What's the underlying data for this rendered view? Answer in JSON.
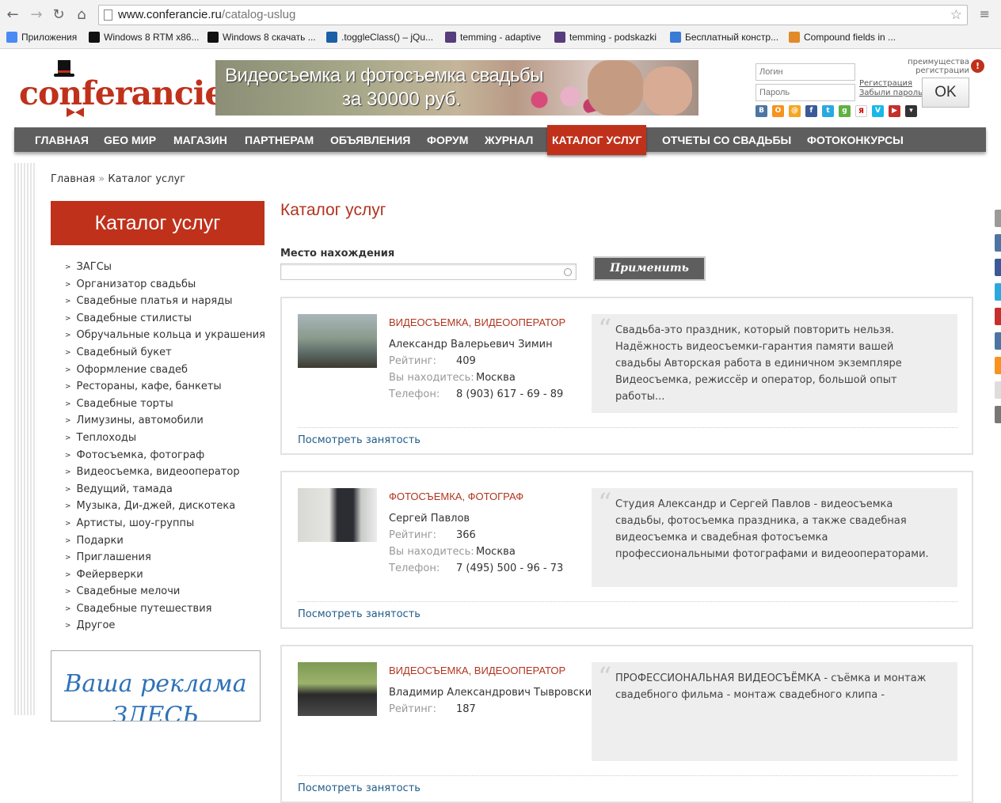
{
  "browser": {
    "url_host": "www.conferancie.ru",
    "url_path": "/catalog-uslug",
    "bookmarks": [
      {
        "label": "Приложения",
        "icon": "apps-grid-icon",
        "color": "#4a8af4"
      },
      {
        "label": "Windows 8 RTM x86...",
        "icon": "tabs-site-icon",
        "color": "#111111"
      },
      {
        "label": "Windows 8 скачать ...",
        "icon": "tabs-site-icon",
        "color": "#111111"
      },
      {
        "label": ".toggleClass() – jQu...",
        "icon": "jquery-icon",
        "color": "#1b5fa6"
      },
      {
        "label": "temming - adaptive",
        "icon": "bootstrap-icon",
        "color": "#563d7c"
      },
      {
        "label": "temming - podskazki",
        "icon": "bootstrap-icon",
        "color": "#563d7c"
      },
      {
        "label": "Бесплатный констр...",
        "icon": "constructor-icon",
        "color": "#3a7bd5"
      },
      {
        "label": "Compound fields in ...",
        "icon": "puzzle-icon",
        "color": "#e08a2a"
      }
    ]
  },
  "header": {
    "logo_text": "conferancie",
    "banner_line1": "Видеосъемка и фотосъемка свадьбы",
    "banner_line2": "за 30000 руб.",
    "login_placeholder": "Логин",
    "password_placeholder": "Пароль",
    "register_link": "Регистрация",
    "forgot_link": "Забыли пароль?",
    "ok_label": "OK",
    "privileges_line1": "преимущества",
    "privileges_line2": "регистрации",
    "privileges_icon": "!",
    "socials": [
      {
        "icon": "vk-icon",
        "color": "#4c75a3",
        "glyph": "B"
      },
      {
        "icon": "odnoklassniki-icon",
        "color": "#f7931e",
        "glyph": "O"
      },
      {
        "icon": "mailru-icon",
        "color": "#f5a623",
        "glyph": "@"
      },
      {
        "icon": "facebook-icon",
        "color": "#3b5998",
        "glyph": "f"
      },
      {
        "icon": "twitter-icon",
        "color": "#2aa9e0",
        "glyph": "t"
      },
      {
        "icon": "google-icon",
        "color": "#5fb142",
        "glyph": "g"
      },
      {
        "icon": "yandex-icon",
        "color": "#ffffff",
        "glyph": "Я"
      },
      {
        "icon": "vimeo-icon",
        "color": "#1ab7ea",
        "glyph": "V"
      },
      {
        "icon": "youtube-icon",
        "color": "#c4302b",
        "glyph": "▶"
      },
      {
        "icon": "dropdown-more-icon",
        "color": "#333333",
        "glyph": "▾"
      }
    ]
  },
  "nav": {
    "items": [
      "ГЛАВНАЯ",
      "GEO МИР",
      "МАГАЗИН",
      "ПАРТНЕРАМ",
      "ОБЪЯВЛЕНИЯ",
      "ФОРУМ",
      "ЖУРНАЛ",
      "КАТАЛОГ УСЛУГ",
      "ОТЧЕТЫ СО СВАДЬБЫ",
      "ФОТОКОНКУРСЫ"
    ],
    "active": "КАТАЛОГ УСЛУГ"
  },
  "breadcrumb": {
    "home": "Главная",
    "separator": "»",
    "current": "Каталог услуг"
  },
  "sidebar": {
    "title": "Каталог услуг",
    "categories": [
      "ЗАГСы",
      "Организатор свадьбы",
      "Свадебные платья и наряды",
      "Свадебные стилисты",
      "Обручальные кольца и украшения",
      "Свадебный букет",
      "Оформление свадеб",
      "Рестораны, кафе, банкеты",
      "Свадебные торты",
      "Лимузины, автомобили",
      "Теплоходы",
      "Фотосъемка, фотограф",
      "Видеосъемка, видеооператор",
      "Ведущий, тамада",
      "Музыка, Ди-джей, дискотека",
      "Артисты, шоу-группы",
      "Подарки",
      "Приглашения",
      "Фейерверки",
      "Свадебные мелочи",
      "Свадебные путешествия",
      "Другое"
    ],
    "ad_line1": "Ваша реклама",
    "ad_line2": "ЗДЕСЬ"
  },
  "main": {
    "title": "Каталог услуг",
    "location_label": "Место нахождения",
    "location_value": "",
    "apply_label": "Применить",
    "labels": {
      "rating": "Рейтинг:",
      "location": "Вы находитесь:",
      "phone": "Телефон:",
      "busy_link": "Посмотреть занятость"
    },
    "listings": [
      {
        "category": "ВИДЕОСЪЕМКА, ВИДЕООПЕРАТОР",
        "name": "Александр Валерьевич Зимин",
        "rating": "409",
        "city": "Москва",
        "phone": "8 (903) 617 - 69 - 89",
        "quote": "Свадьба-это праздник, который повторить нельзя. Надёжность видеосъемки-гарантия памяти вашей свадьбы Авторская работа в единичном экземпляре Видеосъемка, режиссёр и оператор, большой опыт работы..."
      },
      {
        "category": "ФОТОСЪЕМКА, ФОТОГРАФ",
        "name": "Сергей Павлов",
        "rating": "366",
        "city": "Москва",
        "phone": "7 (495) 500 - 96 - 73",
        "quote": "Студия Александр и Сергей Павлов - видеосъемка свадьбы, фотосъемка праздника, а также свадебная видеосъемка и свадебная фотосъемка профессиональными фотографами и видеооператорами."
      },
      {
        "category": "ВИДЕОСЪЕМКА, ВИДЕООПЕРАТОР",
        "name": "Владимир Александрович Тывровский",
        "rating": "187",
        "city": "",
        "phone": "",
        "quote": "ПРОФЕССИОНАЛЬНАЯ ВИДЕОСЪЁМКА - съёмка и монтаж свадебного фильма - монтаж свадебного клипа -"
      }
    ]
  },
  "colors": {
    "accent": "#c0311b",
    "nav_bg": "#5e5e5e",
    "link": "#1f5b8a"
  }
}
